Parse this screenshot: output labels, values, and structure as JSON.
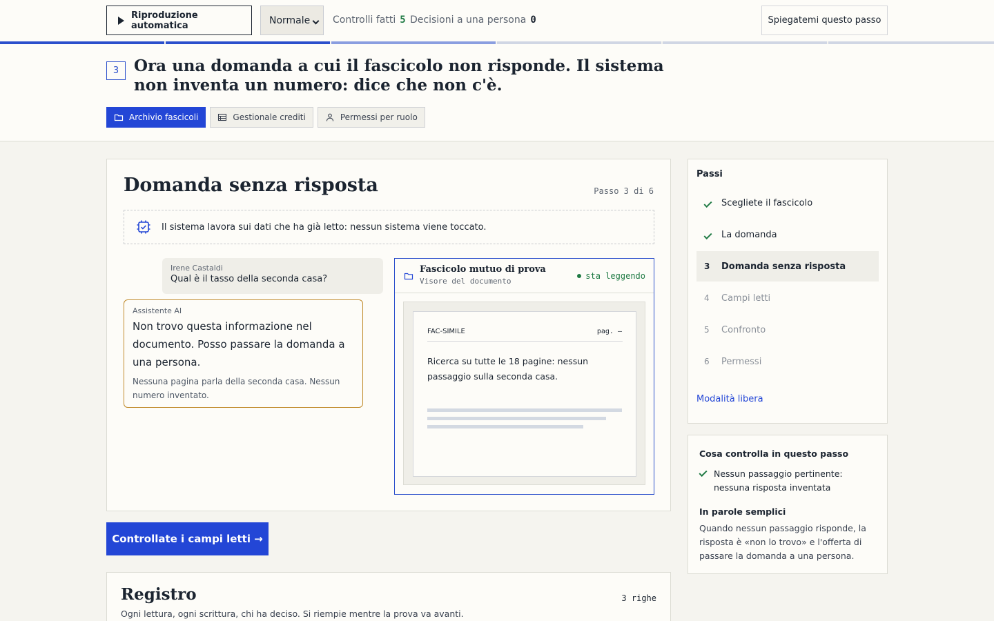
{
  "toolbar": {
    "autoplay_label": "Riproduzione automatica",
    "speed_value": "Normale",
    "checks_label": "Controlli fatti",
    "checks_count": "5",
    "decisions_label": "Decisioni a una persona",
    "decisions_count": "0",
    "explain_label": "Spiegatemi questo passo"
  },
  "header": {
    "step_number": "3",
    "title": "Ora una domanda a cui il fascicolo non risponde. Il sistema non inventa un numero: dice che non c'è.",
    "sources": [
      {
        "label": "Archivio fascicoli",
        "icon": "folder-icon",
        "active": true
      },
      {
        "label": "Gestionale crediti",
        "icon": "table-icon",
        "active": false
      },
      {
        "label": "Permessi per ruolo",
        "icon": "person-icon",
        "active": false
      }
    ]
  },
  "main": {
    "title": "Domanda senza risposta",
    "step_indicator": "Passo 3 di 6",
    "note": "Il sistema lavora sui dati che ha già letto: nessun sistema viene toccato.",
    "user": {
      "name": "Irene Castaldi",
      "question": "Qual è il tasso della seconda casa?"
    },
    "assistant": {
      "name": "Assistente AI",
      "answer": "Non trovo questa informazione nel documento. Posso passare la domanda a una persona.",
      "detail": "Nessuna pagina parla della seconda casa. Nessun numero inventato."
    },
    "viewer": {
      "title": "Fascicolo mutuo di prova",
      "subtitle": "Visore del documento",
      "status": "sta leggendo",
      "doc_label": "FAC-SIMILE",
      "page_label": "pag. —",
      "doc_text": "Ricerca su tutte le 18 pagine: nessun passaggio sulla seconda casa."
    }
  },
  "cta_label": "Controllate i campi letti →",
  "registro": {
    "title": "Registro",
    "count": "3 righe",
    "subtitle": "Ogni lettura, ogni scrittura, chi ha deciso. Si riempie mentre la prova va avanti."
  },
  "steps": {
    "title": "Passi",
    "items": [
      {
        "number": "1",
        "label": "Scegliete il fascicolo",
        "state": "done"
      },
      {
        "number": "2",
        "label": "La domanda",
        "state": "done"
      },
      {
        "number": "3",
        "label": "Domanda senza risposta",
        "state": "current"
      },
      {
        "number": "4",
        "label": "Campi letti",
        "state": "todo"
      },
      {
        "number": "5",
        "label": "Confronto",
        "state": "todo"
      },
      {
        "number": "6",
        "label": "Permessi",
        "state": "todo"
      }
    ],
    "free_mode": "Modalità libera"
  },
  "checks": {
    "title": "Cosa controlla in questo passo",
    "item": "Nessun passaggio pertinente: nessuna risposta inventata",
    "simple_title": "In parole semplici",
    "simple_text": "Quando nessun passaggio risponde, la risposta è «non lo trovo» e l'offerta di passare la domanda a una persona."
  },
  "colors": {
    "accent": "#2346d6",
    "ok": "#1f7a44",
    "ai_border": "#c08a2a"
  }
}
